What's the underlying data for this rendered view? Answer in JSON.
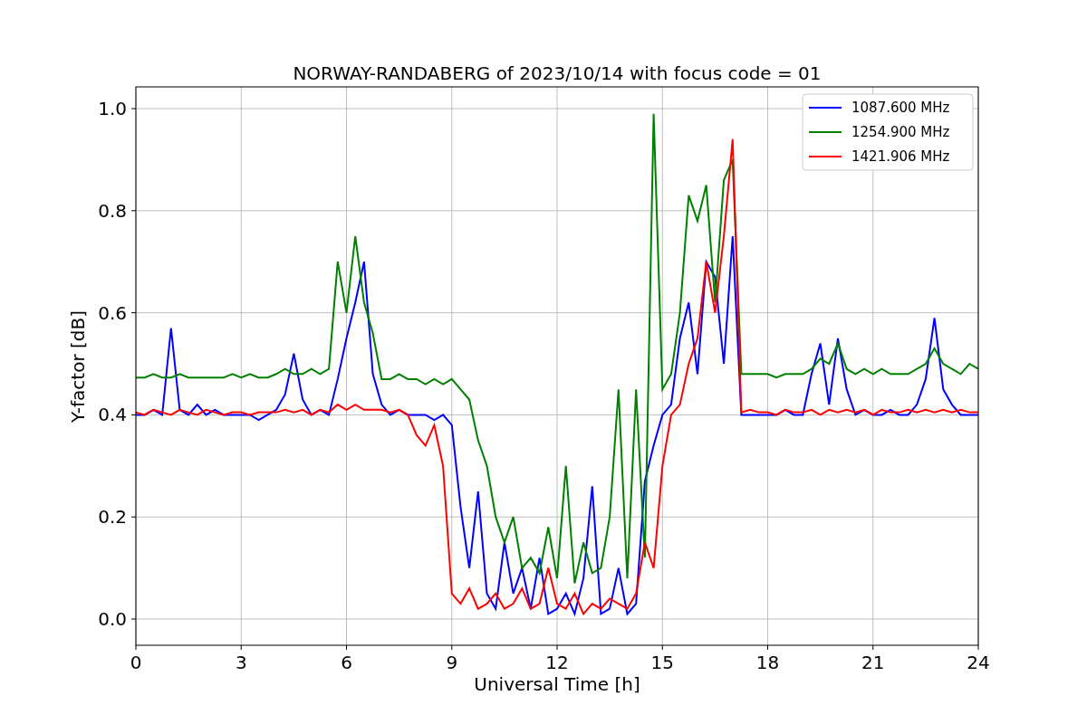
{
  "figure": {
    "chart_data": {
      "type": "line",
      "title": "NORWAY-RANDABERG of 2023/10/14 with focus code = 01",
      "xlabel": "Universal Time [h]",
      "ylabel": "Y-factor [dB]",
      "x": [
        0,
        0.25,
        0.5,
        0.75,
        1,
        1.25,
        1.5,
        1.75,
        2,
        2.25,
        2.5,
        2.75,
        3,
        3.25,
        3.5,
        3.75,
        4,
        4.25,
        4.5,
        4.75,
        5,
        5.25,
        5.5,
        5.75,
        6,
        6.25,
        6.5,
        6.75,
        7,
        7.25,
        7.5,
        7.75,
        8,
        8.25,
        8.5,
        8.75,
        9,
        9.25,
        9.5,
        9.75,
        10,
        10.25,
        10.5,
        10.75,
        11,
        11.25,
        11.5,
        11.75,
        12,
        12.25,
        12.5,
        12.75,
        13,
        13.25,
        13.5,
        13.75,
        14,
        14.25,
        14.5,
        14.75,
        15,
        15.25,
        15.5,
        15.75,
        16,
        16.25,
        16.5,
        16.75,
        17,
        17.25,
        17.5,
        17.75,
        18,
        18.25,
        18.5,
        18.75,
        19,
        19.25,
        19.5,
        19.75,
        20,
        20.25,
        20.5,
        20.75,
        21,
        21.25,
        21.5,
        21.75,
        22,
        22.25,
        22.5,
        22.75,
        23,
        23.25,
        23.5,
        23.75,
        24
      ],
      "series": [
        {
          "name": "1087.600 MHz",
          "color": "#0000ff",
          "values": [
            0.4,
            0.4,
            0.41,
            0.4,
            0.57,
            0.41,
            0.4,
            0.42,
            0.4,
            0.41,
            0.4,
            0.4,
            0.4,
            0.4,
            0.39,
            0.4,
            0.41,
            0.44,
            0.52,
            0.43,
            0.4,
            0.41,
            0.4,
            0.47,
            0.55,
            0.62,
            0.7,
            0.48,
            0.42,
            0.4,
            0.41,
            0.4,
            0.4,
            0.4,
            0.39,
            0.4,
            0.38,
            0.22,
            0.1,
            0.25,
            0.05,
            0.02,
            0.15,
            0.05,
            0.1,
            0.02,
            0.12,
            0.01,
            0.02,
            0.05,
            0.01,
            0.08,
            0.26,
            0.01,
            0.02,
            0.1,
            0.01,
            0.03,
            0.27,
            0.34,
            0.4,
            0.42,
            0.55,
            0.62,
            0.48,
            0.7,
            0.67,
            0.5,
            0.75,
            0.4,
            0.4,
            0.4,
            0.4,
            0.4,
            0.41,
            0.4,
            0.4,
            0.48,
            0.54,
            0.42,
            0.55,
            0.45,
            0.4,
            0.41,
            0.4,
            0.4,
            0.41,
            0.4,
            0.4,
            0.42,
            0.47,
            0.59,
            0.45,
            0.42,
            0.4,
            0.4,
            0.4
          ]
        },
        {
          "name": "1254.900 MHz",
          "color": "#008000",
          "values": [
            0.473,
            0.473,
            0.48,
            0.473,
            0.473,
            0.48,
            0.473,
            0.473,
            0.473,
            0.473,
            0.473,
            0.48,
            0.473,
            0.48,
            0.473,
            0.473,
            0.48,
            0.49,
            0.48,
            0.48,
            0.49,
            0.48,
            0.49,
            0.7,
            0.6,
            0.75,
            0.62,
            0.56,
            0.47,
            0.47,
            0.48,
            0.47,
            0.47,
            0.46,
            0.47,
            0.46,
            0.47,
            0.45,
            0.43,
            0.35,
            0.3,
            0.2,
            0.15,
            0.2,
            0.1,
            0.12,
            0.09,
            0.18,
            0.08,
            0.3,
            0.07,
            0.15,
            0.09,
            0.1,
            0.2,
            0.45,
            0.08,
            0.45,
            0.12,
            0.99,
            0.45,
            0.48,
            0.6,
            0.83,
            0.78,
            0.85,
            0.62,
            0.86,
            0.9,
            0.48,
            0.48,
            0.48,
            0.48,
            0.473,
            0.48,
            0.48,
            0.48,
            0.49,
            0.51,
            0.5,
            0.54,
            0.49,
            0.48,
            0.49,
            0.48,
            0.49,
            0.48,
            0.48,
            0.48,
            0.49,
            0.5,
            0.53,
            0.5,
            0.49,
            0.48,
            0.5,
            0.49
          ]
        },
        {
          "name": "1421.906 MHz",
          "color": "#ff0000",
          "values": [
            0.405,
            0.4,
            0.41,
            0.405,
            0.4,
            0.41,
            0.405,
            0.4,
            0.41,
            0.405,
            0.4,
            0.405,
            0.405,
            0.4,
            0.405,
            0.405,
            0.405,
            0.41,
            0.405,
            0.41,
            0.4,
            0.41,
            0.405,
            0.42,
            0.41,
            0.42,
            0.41,
            0.41,
            0.41,
            0.405,
            0.41,
            0.4,
            0.36,
            0.34,
            0.38,
            0.3,
            0.05,
            0.03,
            0.06,
            0.02,
            0.03,
            0.05,
            0.02,
            0.03,
            0.06,
            0.02,
            0.03,
            0.1,
            0.03,
            0.02,
            0.05,
            0.01,
            0.03,
            0.02,
            0.04,
            0.03,
            0.02,
            0.05,
            0.15,
            0.1,
            0.3,
            0.4,
            0.42,
            0.5,
            0.55,
            0.7,
            0.6,
            0.75,
            0.94,
            0.405,
            0.41,
            0.405,
            0.405,
            0.4,
            0.41,
            0.405,
            0.405,
            0.41,
            0.4,
            0.41,
            0.405,
            0.41,
            0.405,
            0.41,
            0.4,
            0.41,
            0.405,
            0.405,
            0.41,
            0.405,
            0.41,
            0.405,
            0.41,
            0.405,
            0.41,
            0.405,
            0.405
          ]
        }
      ],
      "grid": true,
      "legend": true,
      "xlim": [
        0,
        24
      ],
      "ylim": [
        -0.0514,
        1.0426
      ],
      "xticks": [
        0,
        3,
        6,
        9,
        12,
        15,
        18,
        21,
        24
      ],
      "yticks": [
        {
          "value": 0,
          "label": "0.0"
        },
        {
          "value": 0.2,
          "label": "0.2"
        },
        {
          "value": 0.4,
          "label": "0.4"
        },
        {
          "value": 0.6,
          "label": "0.6"
        },
        {
          "value": 0.8,
          "label": "0.8"
        },
        {
          "value": 1,
          "label": "1.0"
        }
      ]
    }
  }
}
